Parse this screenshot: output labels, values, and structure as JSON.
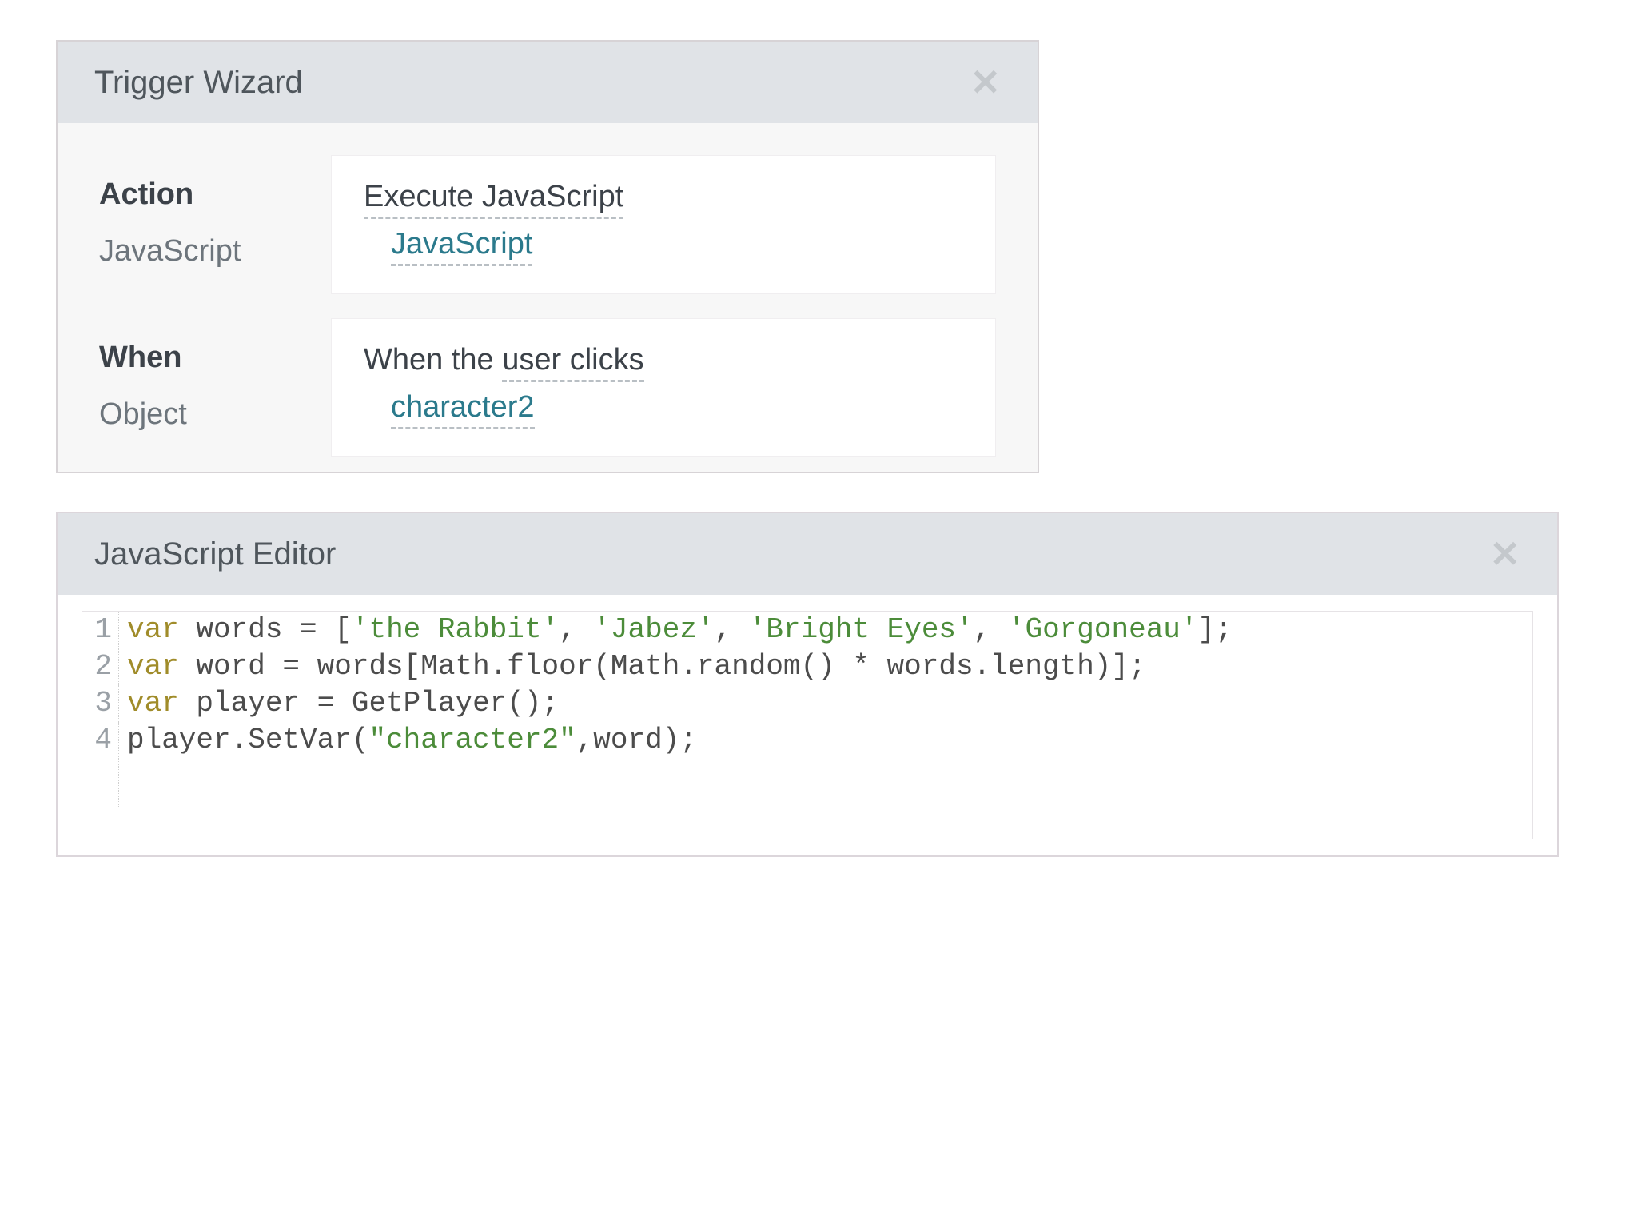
{
  "trigger_wizard": {
    "title": "Trigger Wizard",
    "action_section": {
      "label_action": "Action",
      "label_javascript": "JavaScript",
      "action_value": "Execute JavaScript",
      "javascript_link": "JavaScript"
    },
    "when_section": {
      "label_when": "When",
      "label_object": "Object",
      "when_prefix": "When the ",
      "when_value": "user clicks",
      "object_value": "character2"
    }
  },
  "js_editor": {
    "title": "JavaScript Editor",
    "lines": [
      {
        "n": "1",
        "kw": "var",
        "rest_before_strings": " words = [",
        "strings": [
          "'the Rabbit'",
          "'Jabez'",
          "'Bright Eyes'",
          "'Gorgoneau'"
        ],
        "between": ", ",
        "rest_after": "];"
      },
      {
        "n": "2",
        "kw": "var",
        "rest": " word = words[Math.floor(Math.random() * words.length)];"
      },
      {
        "n": "3",
        "kw": "var",
        "rest": " player = GetPlayer();"
      },
      {
        "n": "4",
        "kw": "",
        "rest_before": "player.SetVar(",
        "str": "\"character2\"",
        "rest_after": ",word);"
      }
    ]
  }
}
